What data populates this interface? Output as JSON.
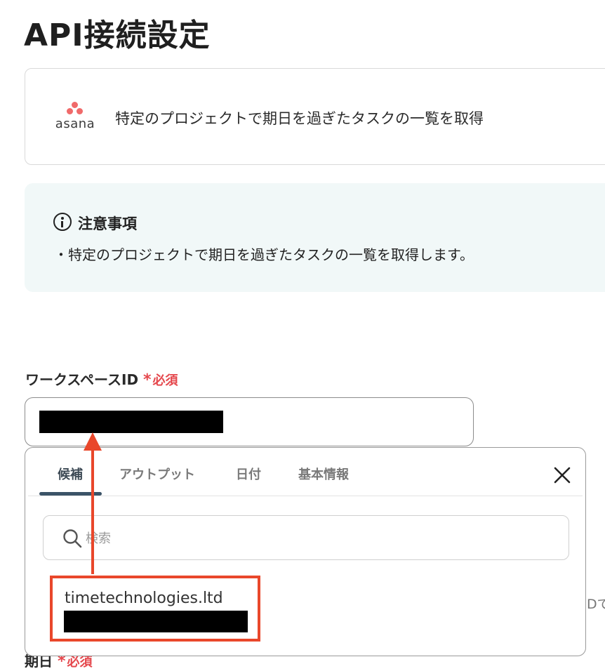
{
  "page": {
    "title": "API接続設定"
  },
  "app_card": {
    "logo_text": "asana",
    "action": "特定のプロジェクトで期日を過ぎたタスクの一覧を取得"
  },
  "notice": {
    "heading": "注意事項",
    "body": "・特定のプロジェクトで期日を過ぎたタスクの一覧を取得します。"
  },
  "fields": {
    "workspace": {
      "label": "ワークスペースID",
      "required": "必須",
      "required_mark": "*"
    },
    "due_date": {
      "label": "期日",
      "required": "必須",
      "required_mark": "*"
    },
    "partial_help_text": "Dで"
  },
  "popover": {
    "tabs": [
      {
        "label": "候補",
        "active": true
      },
      {
        "label": "アウトプット",
        "active": false
      },
      {
        "label": "日付",
        "active": false
      },
      {
        "label": "基本情報",
        "active": false
      }
    ],
    "search": {
      "placeholder": "検索",
      "value": ""
    },
    "candidates": [
      {
        "name": "timetechnologies.ltd"
      }
    ]
  },
  "colors": {
    "required": "#e5484d",
    "annotation": "#e9472b",
    "notice_bg": "#f1f8f8",
    "asana": "#f06a6a",
    "tab_indicator": "#3b5367"
  },
  "icons": [
    "asana-logo",
    "info-circle-icon",
    "close-icon",
    "search-icon",
    "annotation-arrow"
  ]
}
